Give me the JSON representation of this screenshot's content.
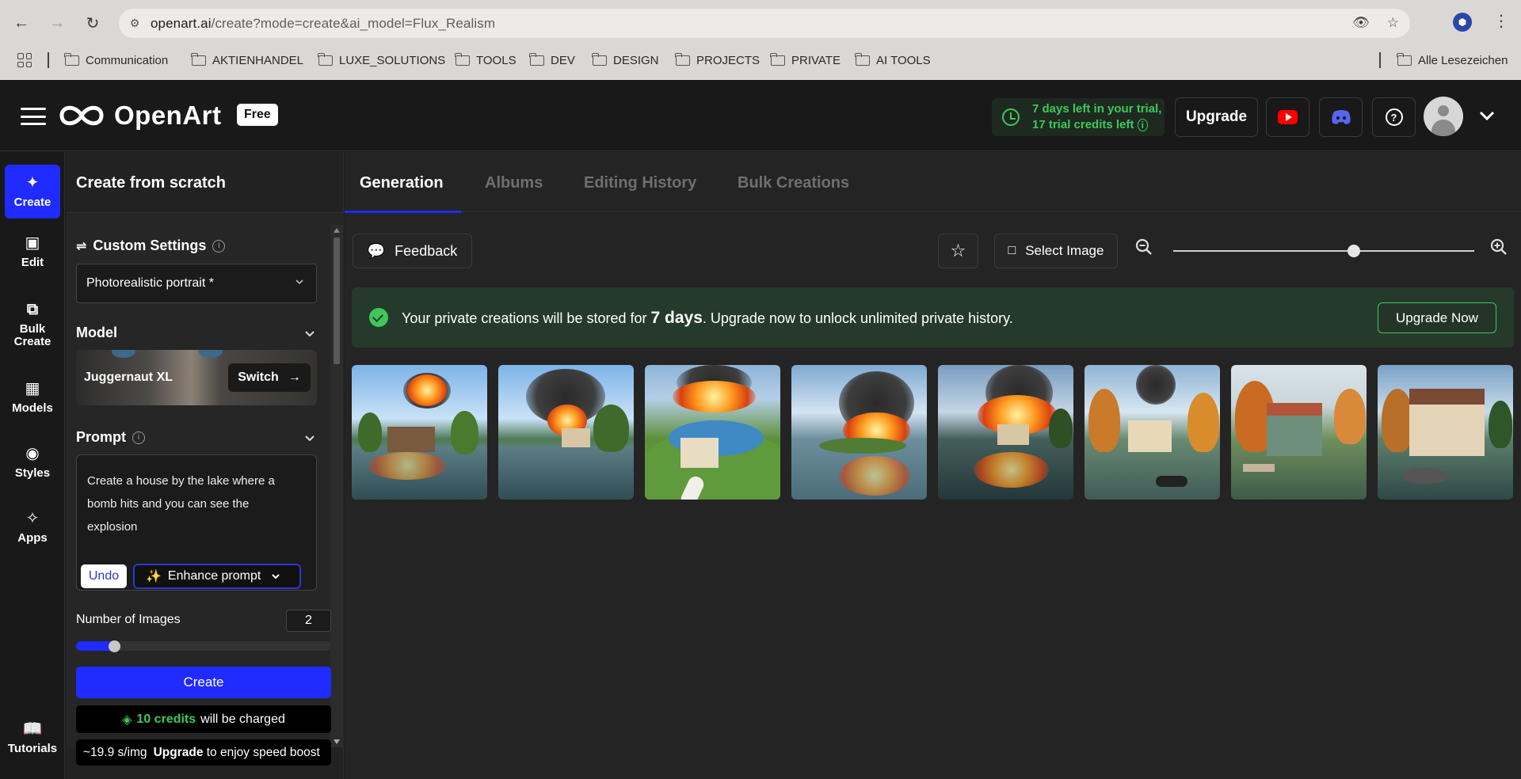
{
  "browser": {
    "url_host": "openart.ai",
    "url_path": "/create?mode=create&ai_model=Flux_Realism",
    "bookmarks": [
      "Communication",
      "AKTIENHANDEL",
      "LUXE_SOLUTIONS",
      "TOOLS",
      "DEV",
      "DESIGN",
      "PROJECTS",
      "PRIVATE",
      "AI TOOLS"
    ],
    "all_bookmarks": "Alle Lesezeichen"
  },
  "header": {
    "logo_text": "OpenArt",
    "badge": "Free",
    "trial_line1": "7 days left in your trial,",
    "trial_line2": "17 trial credits left",
    "upgrade": "Upgrade"
  },
  "rail": {
    "items": [
      {
        "label": "Create",
        "icon": "create-sparkle-icon"
      },
      {
        "label": "Edit",
        "icon": "edit-frame-icon"
      },
      {
        "label": "Bulk Create",
        "icon": "bulk-copy-icon"
      },
      {
        "label": "Models",
        "icon": "models-grid-icon"
      },
      {
        "label": "Styles",
        "icon": "palette-icon"
      },
      {
        "label": "Apps",
        "icon": "apps-sparkle-icon"
      }
    ],
    "tutorials": "Tutorials"
  },
  "panel": {
    "title": "Create from scratch",
    "custom_settings": "Custom Settings",
    "preset": "Photorealistic portrait *",
    "model_label": "Model",
    "model_name": "Juggernaut XL",
    "switch": "Switch",
    "prompt_label": "Prompt",
    "prompt_text": "Create a house by the lake where a bomb hits and you can see the explosion",
    "undo": "Undo",
    "enhance": "Enhance prompt",
    "num_images_label": "Number of Images",
    "num_images": "2",
    "num_images_fraction": 0.12,
    "create": "Create",
    "credits_value": "10 credits",
    "credits_suffix": "will be charged",
    "speed": "~19.9 s/img",
    "speed_upgrade": "Upgrade",
    "speed_suffix": "to enjoy speed boost"
  },
  "main": {
    "tabs": [
      "Generation",
      "Albums",
      "Editing History",
      "Bulk Creations"
    ],
    "feedback": "Feedback",
    "select_image": "Select Image",
    "zoom_fraction": 0.6,
    "banner_pre": "Your private creations will be stored for",
    "banner_days": "7 days",
    "banner_post": ". Upgrade now to unlock unlimited private history.",
    "upgrade_now": "Upgrade Now"
  },
  "colors": {
    "accent": "#1f2bff",
    "success": "#3fc75b"
  }
}
